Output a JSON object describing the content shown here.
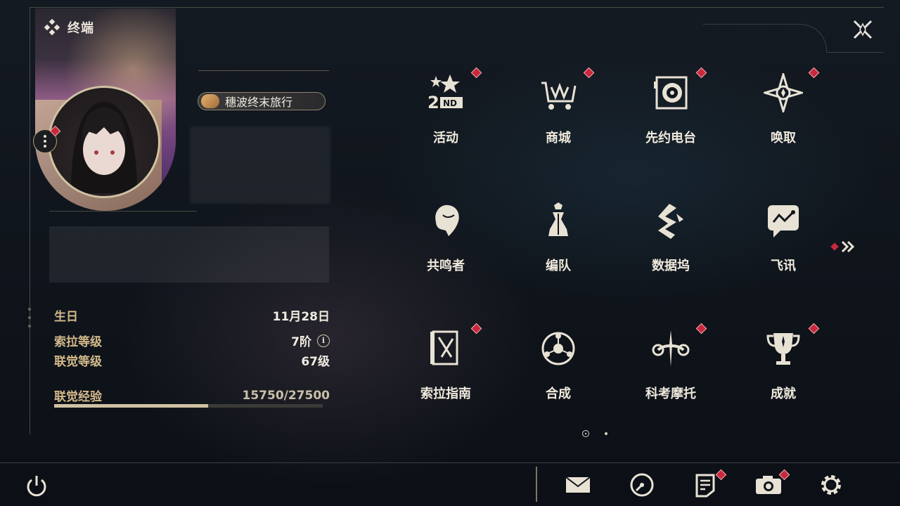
{
  "header": {
    "title": "终端",
    "menu_icon": "diamond-cluster-icon",
    "close_icon": "close-icon"
  },
  "profile": {
    "title_badge": "穗波终末旅行",
    "birthday_label": "生日",
    "birthday_value": "11月28日",
    "sola_level_label": "索拉等级",
    "sola_level_value": "7阶",
    "union_level_label": "联觉等级",
    "union_level_value": "67级",
    "union_exp_label": "联觉经验",
    "union_exp_value": "15750/27500",
    "union_exp_progress": 0.573
  },
  "grid": [
    {
      "label": "活动",
      "icon": "event-2nd-icon",
      "badge": true
    },
    {
      "label": "商城",
      "icon": "shop-cart-icon",
      "badge": true
    },
    {
      "label": "先约电台",
      "icon": "radio-icon",
      "badge": true
    },
    {
      "label": "唤取",
      "icon": "compass-star-icon",
      "badge": true
    },
    {
      "label": "共鸣者",
      "icon": "character-head-icon",
      "badge": false
    },
    {
      "label": "编队",
      "icon": "chess-team-icon",
      "badge": false
    },
    {
      "label": "数据坞",
      "icon": "data-bank-icon",
      "badge": false
    },
    {
      "label": "飞讯",
      "icon": "chat-message-icon",
      "badge": false
    },
    {
      "label": "索拉指南",
      "icon": "guide-book-icon",
      "badge": true
    },
    {
      "label": "合成",
      "icon": "synthesis-icon",
      "badge": false
    },
    {
      "label": "科考摩托",
      "icon": "motorbike-icon",
      "badge": true
    },
    {
      "label": "成就",
      "icon": "trophy-icon",
      "badge": true
    }
  ],
  "pagination": {
    "current": 1,
    "total": 2
  },
  "colors": {
    "accent": "#cfc1a3",
    "label_gold": "#d4b98a",
    "badge_red": "#c8283d",
    "background": "#11161d"
  }
}
